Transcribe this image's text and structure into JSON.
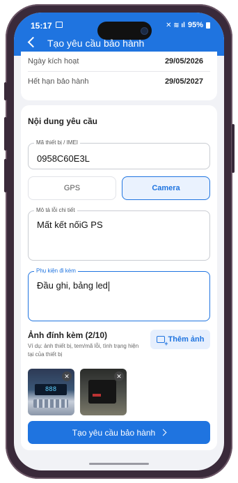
{
  "status_bar": {
    "time": "15:17",
    "battery": "95%",
    "signal_icons": "mute-wifi-signal"
  },
  "header": {
    "title": "Tạo yêu cầu bảo hành",
    "back_icon": "chevron-left-icon",
    "background": "#1f74e0"
  },
  "warranty_info": [
    {
      "label": "Ngày kích hoạt",
      "value": "29/05/2026"
    },
    {
      "label": "Hết hạn bảo hành",
      "value": "29/05/2027"
    }
  ],
  "request": {
    "title": "Nội dung yêu cầu",
    "imei_field": {
      "label": "Mã thiết bị / IMEI",
      "value": "0958C60E3L"
    },
    "device_types": [
      {
        "label": "GPS",
        "selected": false
      },
      {
        "label": "Camera",
        "selected": true
      }
    ],
    "description_field": {
      "label": "Mô tả lỗi chi tiết",
      "value": "Mất kết nốiG PS"
    },
    "accessories_field": {
      "label": "Phụ kiện đi kèm",
      "value": "Đầu ghi, bảng led"
    },
    "attachments": {
      "title": "Ảnh đính kèm (2/10)",
      "hint": "Ví dụ: ảnh thiết bị, tem/mã lỗi, tình trạng hiện tại của thiết bị",
      "add_button": "Thêm ảnh",
      "photo1_display": "888"
    },
    "submit_button": "Tạo yêu cầu bảo hành"
  },
  "colors": {
    "accent": "#1f74e0",
    "selected_bg": "#eaf2fe"
  }
}
